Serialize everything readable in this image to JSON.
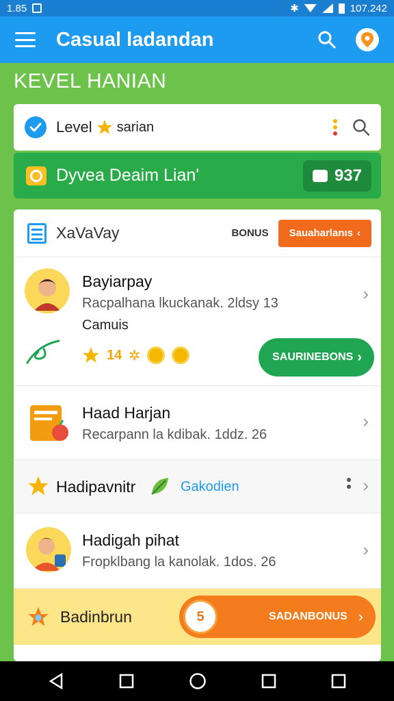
{
  "status_bar": {
    "time": "1.85",
    "right_text": "107.242"
  },
  "app_bar": {
    "title": "Casual ladandan"
  },
  "section_title": "KEVEL HANIAN",
  "level_bar": {
    "label": "Level",
    "sub_label": "sarian"
  },
  "green_banner": {
    "text": "Dyvea Deaim Lian'",
    "score": "937"
  },
  "panel": {
    "title": "XaVaVay",
    "bonus_label": "BONUS",
    "action_button": "Sauaharlanıs"
  },
  "rows": [
    {
      "name": "Bayiarpay",
      "desc": "Racpalhana lkuckanak. 2ldsy 13",
      "extra": "Camuis",
      "reward_count": "14",
      "button": "SAURINEBONS"
    },
    {
      "name": "Haad Harjan",
      "desc": "Recarpann la kdibak. 1ddz. 26"
    },
    {
      "name": "Hadipavnitr",
      "tag": "Gakodien"
    },
    {
      "name": "Hadigah pihat",
      "desc": "Fropklbang la kanolak. 1dos. 26"
    }
  ],
  "yellow_banner": {
    "label": "Badinbrun",
    "circle": "5",
    "button": "SADANBONUS"
  },
  "colors": {
    "primary": "#1d9bf0",
    "accent_green": "#2aab4a",
    "accent_orange": "#f26b1d",
    "background": "#6cc24a"
  }
}
